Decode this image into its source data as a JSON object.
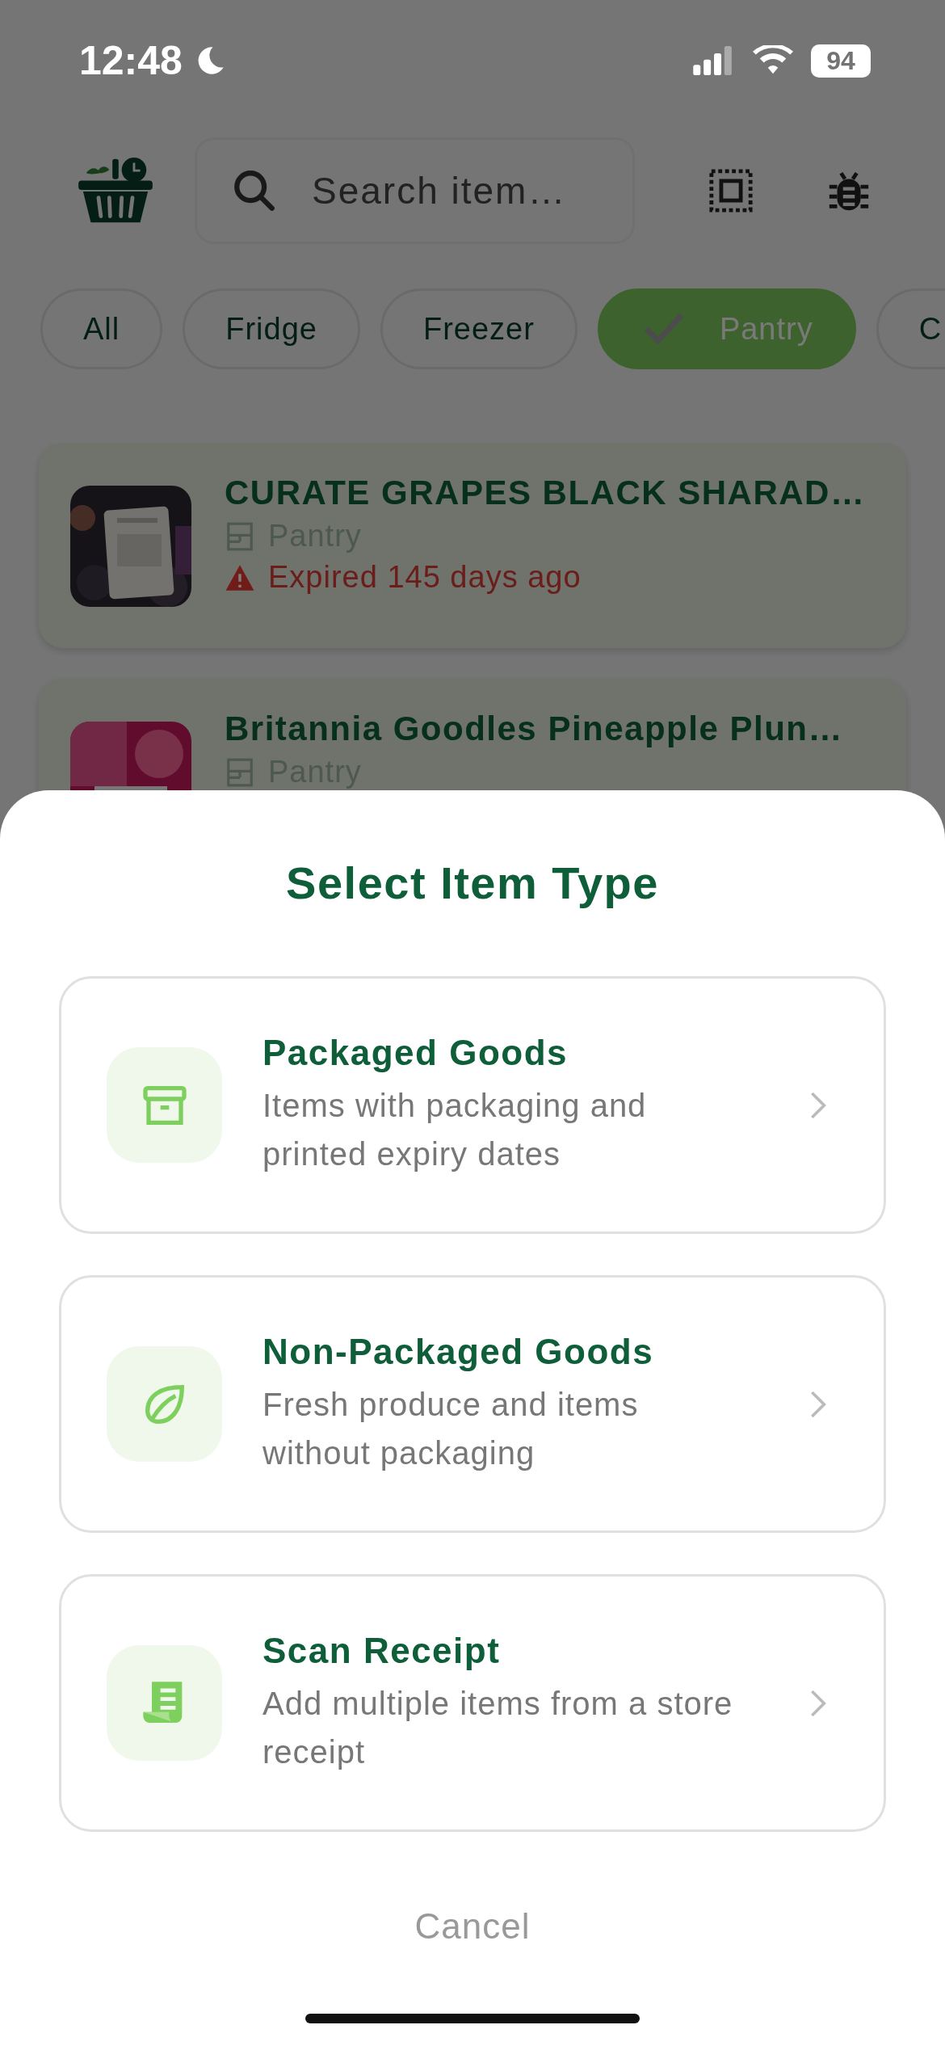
{
  "status_bar": {
    "time": "12:48",
    "battery": "94"
  },
  "search": {
    "placeholder": "Search item…"
  },
  "filters": [
    {
      "label": "All",
      "selected": false
    },
    {
      "label": "Fridge",
      "selected": false
    },
    {
      "label": "Freezer",
      "selected": false
    },
    {
      "label": "Pantry",
      "selected": true
    },
    {
      "label": "C",
      "selected": false
    }
  ],
  "items": [
    {
      "name": "CURATE GRAPES BLACK SHARAD…",
      "location": "Pantry",
      "expiry": "Expired 145 days ago",
      "expired": true
    },
    {
      "name": "Britannia Goodles Pineapple Plun…",
      "location": "Pantry"
    }
  ],
  "sheet": {
    "title": "Select Item Type",
    "options": [
      {
        "kind": "packaged",
        "title": "Packaged Goods",
        "description": "Items with packaging and printed expiry dates"
      },
      {
        "kind": "fresh",
        "title": "Non-Packaged Goods",
        "description": "Fresh produce and items without packaging"
      },
      {
        "kind": "receipt",
        "title": "Scan Receipt",
        "description": "Add multiple items from a store receipt"
      }
    ],
    "cancel": "Cancel"
  }
}
